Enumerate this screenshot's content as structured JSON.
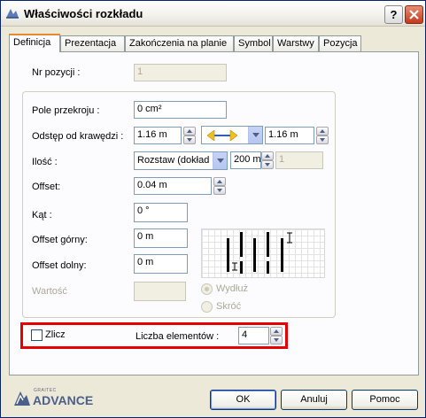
{
  "window": {
    "title": "Właściwości rozkładu"
  },
  "tabs": [
    {
      "label": "Definicja"
    },
    {
      "label": "Prezentacja"
    },
    {
      "label": "Zakończenia na planie"
    },
    {
      "label": "Symbol"
    },
    {
      "label": "Warstwy"
    },
    {
      "label": "Pozycja"
    }
  ],
  "form": {
    "nr_pozycji": {
      "label": "Nr pozycji :",
      "value": "1"
    },
    "pole_przekroju": {
      "label": "Pole przekroju :",
      "value": "0 cm²"
    },
    "odstep": {
      "label": "Odstęp od krawędzi :",
      "left_value": "1.16 m",
      "right_value": "1.16 m"
    },
    "ilosc": {
      "label": "Ilość :",
      "mode": "Rozstaw (dokład",
      "spacing": "200 m",
      "count": "1"
    },
    "offset": {
      "label": "Offset:",
      "value": "0.04 m"
    },
    "kat": {
      "label": "Kąt :",
      "value": "0 °"
    },
    "offset_gorny": {
      "label": "Offset górny:",
      "value": "0 m"
    },
    "offset_dolny": {
      "label": "Offset dolny:",
      "value": "0 m"
    },
    "wartosc": {
      "label": "Wartość",
      "value": ""
    },
    "radio_wydluz": {
      "label": "Wydłuż",
      "checked": true
    },
    "radio_skroc": {
      "label": "Skróć",
      "checked": false
    }
  },
  "count_section": {
    "zlicz_label": "Zlicz",
    "zlicz_checked": false,
    "liczba_label": "Liczba elementów :",
    "liczba_value": "4",
    "highlight_color": "#e60000"
  },
  "buttons": {
    "ok": "OK",
    "cancel": "Anuluj",
    "help": "Pomoc"
  },
  "logo": {
    "text": "ADVANCE",
    "small": "GRAITEC"
  },
  "colors": {
    "accent": "#e68b2c",
    "window_bg": "#ece9d8",
    "close": "#c4391c"
  }
}
